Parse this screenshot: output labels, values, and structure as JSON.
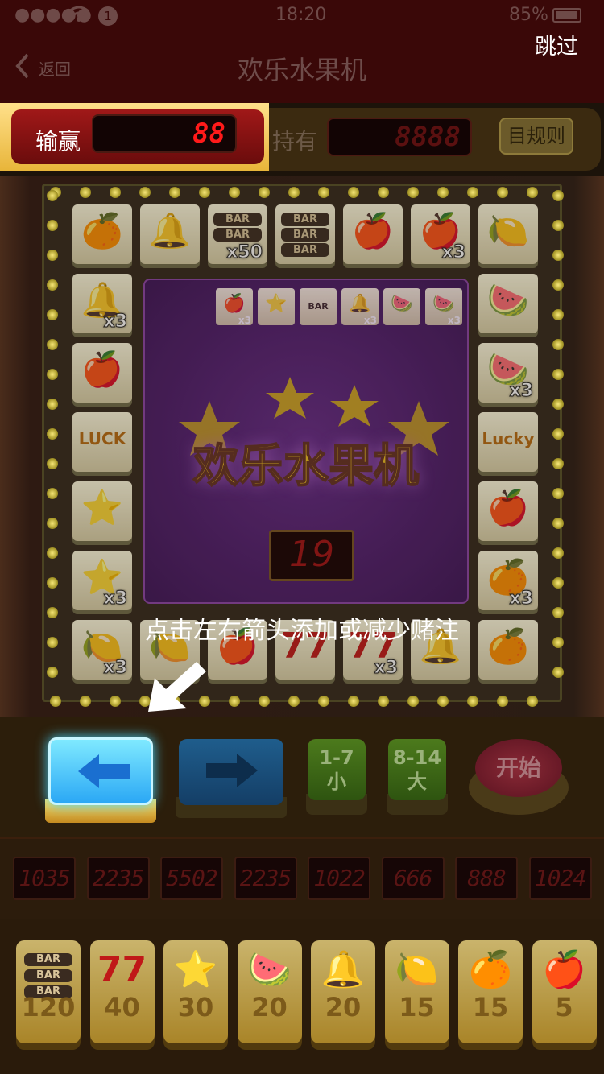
{
  "status": {
    "signal": "●●●●●",
    "time": "18:20",
    "notif": "1",
    "battery": "85%"
  },
  "nav": {
    "back_label": "返回",
    "title": "欢乐水果机",
    "skip": "跳过"
  },
  "score": {
    "win_label": "输赢",
    "win_value": "88",
    "hold_label": "持有",
    "hold_value": "8888",
    "rules_label": "目规则"
  },
  "board": {
    "top_row": [
      {
        "icon": "orange",
        "glyph": "🍊",
        "mult": ""
      },
      {
        "icon": "bell",
        "glyph": "🔔",
        "mult": ""
      },
      {
        "icon": "bar",
        "bars": [
          "BAR",
          "BAR"
        ],
        "mult": "x50"
      },
      {
        "icon": "bar",
        "bars": [
          "BAR",
          "BAR",
          "BAR"
        ],
        "mult": ""
      },
      {
        "icon": "apple",
        "glyph": "🍎",
        "mult": ""
      },
      {
        "icon": "apple",
        "glyph": "🍎",
        "mult": "x3"
      },
      {
        "icon": "lemon",
        "glyph": "🍋",
        "mult": ""
      }
    ],
    "left_col": [
      {
        "icon": "bell",
        "glyph": "🔔",
        "mult": "x3"
      },
      {
        "icon": "apple",
        "glyph": "🍎",
        "mult": ""
      },
      {
        "icon": "lucky",
        "text": "LUCK",
        "mult": ""
      },
      {
        "icon": "star",
        "glyph": "⭐",
        "mult": ""
      },
      {
        "icon": "star",
        "glyph": "⭐",
        "mult": "x3"
      }
    ],
    "right_col": [
      {
        "icon": "watermelon",
        "glyph": "🍉",
        "mult": ""
      },
      {
        "icon": "watermelon",
        "glyph": "🍉",
        "mult": "x3"
      },
      {
        "icon": "lucky",
        "text": "Lucky",
        "mult": ""
      },
      {
        "icon": "apple",
        "glyph": "🍎",
        "mult": ""
      },
      {
        "icon": "orange",
        "glyph": "🍊",
        "mult": "x3"
      }
    ],
    "bottom_row": [
      {
        "icon": "lemon",
        "glyph": "🍋",
        "mult": "x3"
      },
      {
        "icon": "lemon",
        "glyph": "🍋",
        "mult": ""
      },
      {
        "icon": "apple",
        "glyph": "🍎",
        "mult": ""
      },
      {
        "icon": "seven",
        "text": "77",
        "mult": ""
      },
      {
        "icon": "seven",
        "text": "77",
        "mult": "x3"
      },
      {
        "icon": "bell",
        "glyph": "🔔",
        "mult": ""
      },
      {
        "icon": "orange",
        "glyph": "🍊",
        "mult": ""
      }
    ],
    "mini_row": [
      {
        "glyph": "🍎",
        "mult": "x3"
      },
      {
        "glyph": "⭐",
        "mult": ""
      },
      {
        "glyph": "BAR",
        "mult": ""
      },
      {
        "glyph": "🔔",
        "mult": "x3"
      },
      {
        "glyph": "🍉",
        "mult": ""
      },
      {
        "glyph": "🍉",
        "mult": "x3"
      }
    ],
    "center_title": "欢乐水果机",
    "counter": "19"
  },
  "instruction": "点击左右箭头添加或减少赌注",
  "controls": {
    "left_arrow": "←",
    "right_arrow": "→",
    "small_range": "1-7",
    "small_label": "小",
    "big_range": "8-14",
    "big_label": "大",
    "start_label": "开始"
  },
  "odds": [
    "1035",
    "2235",
    "5502",
    "2235",
    "1022",
    "666",
    "888",
    "1024"
  ],
  "bets": [
    {
      "icon": "bar",
      "glyph": "",
      "value": "120"
    },
    {
      "icon": "seven",
      "glyph": "77",
      "value": "40"
    },
    {
      "icon": "star",
      "glyph": "⭐",
      "value": "30"
    },
    {
      "icon": "watermelon",
      "glyph": "🍉",
      "value": "20"
    },
    {
      "icon": "bell",
      "glyph": "🔔",
      "value": "20"
    },
    {
      "icon": "lemon",
      "glyph": "🍋",
      "value": "15"
    },
    {
      "icon": "orange",
      "glyph": "🍊",
      "value": "15"
    },
    {
      "icon": "apple",
      "glyph": "🍎",
      "value": "5"
    }
  ],
  "colors": {
    "highlight_blue": "#2ba8f5",
    "lcd_red": "#ff1a1a",
    "frame_gold": "#e8b53a"
  }
}
